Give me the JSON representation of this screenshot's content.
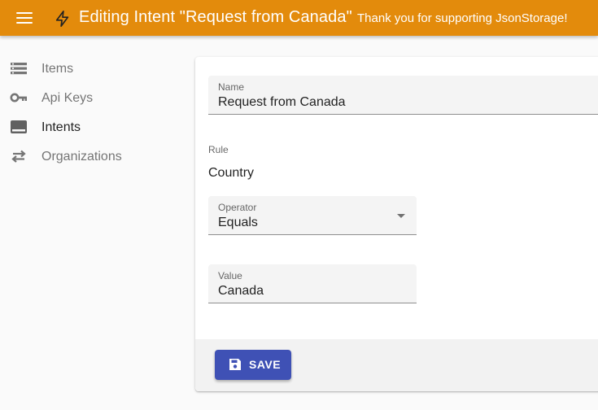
{
  "appbar": {
    "title": "Editing Intent \"Request from Canada\"",
    "subtitle": "Thank you for supporting JsonStorage!",
    "menu_icon": "hamburger-menu-icon",
    "logo_icon": "lightning-bolt-icon",
    "color": "#e38b0c"
  },
  "sidebar": {
    "items": [
      {
        "label": "Items",
        "icon": "list-icon",
        "active": false
      },
      {
        "label": "Api Keys",
        "icon": "key-icon",
        "active": false
      },
      {
        "label": "Intents",
        "icon": "intent-icon",
        "active": true
      },
      {
        "label": "Organizations",
        "icon": "swap-icon",
        "active": false
      }
    ]
  },
  "form": {
    "name": {
      "label": "Name",
      "value": "Request from Canada"
    },
    "rule": {
      "label": "Rule",
      "value": "Country"
    },
    "operator": {
      "label": "Operator",
      "value": "Equals"
    },
    "value": {
      "label": "Value",
      "value": "Canada"
    }
  },
  "actions": {
    "save_label": "SAVE",
    "save_icon": "floppy-disk-icon",
    "button_color": "#3f51b5"
  }
}
